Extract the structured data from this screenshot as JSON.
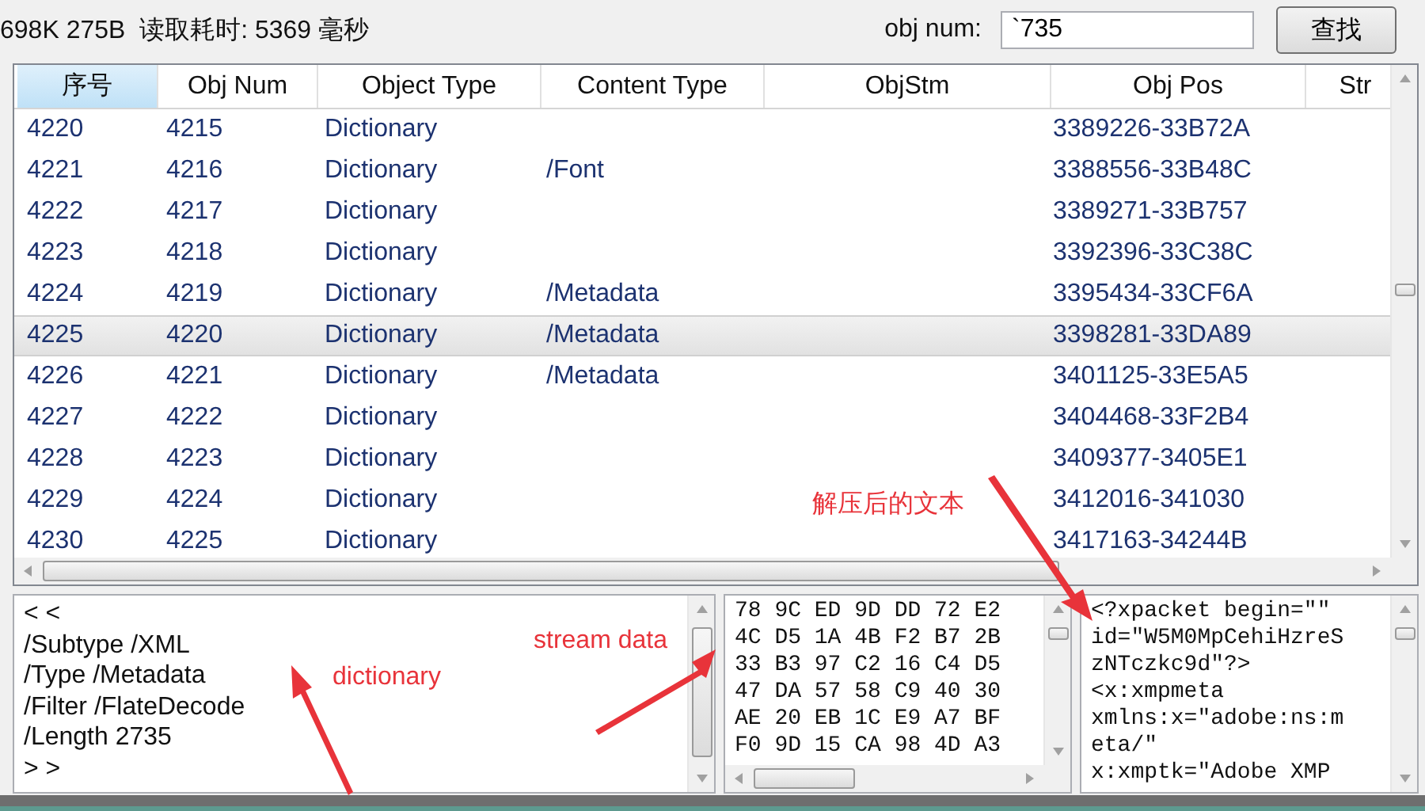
{
  "toolbar": {
    "info": "698K 275B  读取耗时: 5369 毫秒",
    "obj_num_label": "obj num:",
    "obj_num_value": "`735",
    "search_button": "查找"
  },
  "table": {
    "columns": [
      {
        "label": "序号",
        "selected": true
      },
      {
        "label": "Obj Num",
        "selected": false
      },
      {
        "label": "Object Type",
        "selected": false
      },
      {
        "label": "Content Type",
        "selected": false
      },
      {
        "label": "ObjStm",
        "selected": false
      },
      {
        "label": "Obj Pos",
        "selected": false
      },
      {
        "label": "Str",
        "selected": false
      }
    ],
    "rows": [
      {
        "cells": [
          "4220",
          "4215",
          "Dictionary",
          "",
          "",
          "3389226-33B72A"
        ],
        "selected": false
      },
      {
        "cells": [
          "4221",
          "4216",
          "Dictionary",
          "/Font",
          "",
          "3388556-33B48C"
        ],
        "selected": false
      },
      {
        "cells": [
          "4222",
          "4217",
          "Dictionary",
          "",
          "",
          "3389271-33B757"
        ],
        "selected": false
      },
      {
        "cells": [
          "4223",
          "4218",
          "Dictionary",
          "",
          "",
          "3392396-33C38C"
        ],
        "selected": false
      },
      {
        "cells": [
          "4224",
          "4219",
          "Dictionary",
          "/Metadata",
          "",
          "3395434-33CF6A"
        ],
        "selected": false
      },
      {
        "cells": [
          "4225",
          "4220",
          "Dictionary",
          "/Metadata",
          "",
          "3398281-33DA89"
        ],
        "selected": true
      },
      {
        "cells": [
          "4226",
          "4221",
          "Dictionary",
          "/Metadata",
          "",
          "3401125-33E5A5"
        ],
        "selected": false
      },
      {
        "cells": [
          "4227",
          "4222",
          "Dictionary",
          "",
          "",
          "3404468-33F2B4"
        ],
        "selected": false
      },
      {
        "cells": [
          "4228",
          "4223",
          "Dictionary",
          "",
          "",
          "3409377-3405E1"
        ],
        "selected": false
      },
      {
        "cells": [
          "4229",
          "4224",
          "Dictionary",
          "",
          "",
          "3412016-341030"
        ],
        "selected": false
      },
      {
        "cells": [
          "4230",
          "4225",
          "Dictionary",
          "",
          "",
          "3417163-34244B"
        ],
        "selected": false
      }
    ]
  },
  "dictionary_lines": [
    "< <",
    "/Subtype /XML",
    "/Type /Metadata",
    "/Filter /FlateDecode",
    "/Length 2735",
    "> >"
  ],
  "hex_lines": [
    "78 9C ED 9D DD 72 E2",
    "4C D5 1A 4B F2 B7 2B",
    "33 B3 97 C2 16 C4 D5",
    "47 DA 57 58 C9 40 30",
    "AE 20 EB 1C E9 A7 BF",
    "F0 9D 15 CA 98 4D A3"
  ],
  "text_lines": [
    "<?xpacket begin=\"\"",
    "id=\"W5M0MpCehiHzreS",
    "zNTczkc9d\"?>",
    "<x:xmpmeta",
    "xmlns:x=\"adobe:ns:m",
    "eta/\"",
    "x:xmptk=\"Adobe XMP"
  ],
  "annotations": [
    {
      "text": "解压后的文本"
    },
    {
      "text": "stream data"
    },
    {
      "text": "dictionary"
    }
  ]
}
